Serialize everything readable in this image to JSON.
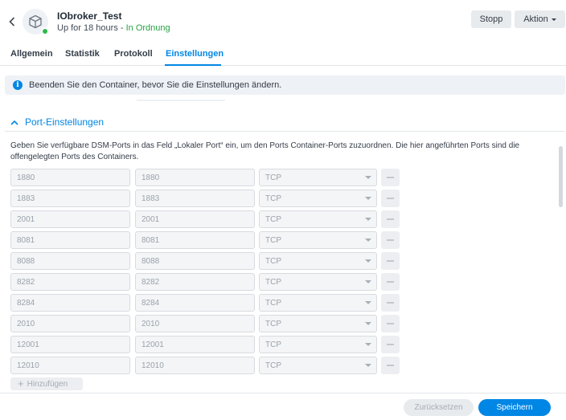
{
  "header": {
    "title": "IObroker_Test",
    "uptime": "Up for 18 hours - ",
    "status": "In Ordnung",
    "stop_label": "Stopp",
    "action_label": "Aktion"
  },
  "tabs": [
    {
      "label": "Allgemein"
    },
    {
      "label": "Statistik"
    },
    {
      "label": "Protokoll"
    },
    {
      "label": "Einstellungen",
      "active": true
    }
  ],
  "info": {
    "message": "Beenden Sie den Container, bevor Sie die Einstellungen ändern."
  },
  "port_section": {
    "title": "Port-Einstellungen",
    "description": "Geben Sie verfügbare DSM-Ports in das Feld „Lokaler Port“ ein, um den Ports Container-Ports zuzuordnen. Die hier angeführten Ports sind die offengelegten Ports des Containers.",
    "rows": [
      {
        "local": "1880",
        "container": "1880",
        "type": "TCP"
      },
      {
        "local": "1883",
        "container": "1883",
        "type": "TCP"
      },
      {
        "local": "2001",
        "container": "2001",
        "type": "TCP"
      },
      {
        "local": "8081",
        "container": "8081",
        "type": "TCP"
      },
      {
        "local": "8088",
        "container": "8088",
        "type": "TCP"
      },
      {
        "local": "8282",
        "container": "8282",
        "type": "TCP"
      },
      {
        "local": "8284",
        "container": "8284",
        "type": "TCP"
      },
      {
        "local": "2010",
        "container": "2010",
        "type": "TCP"
      },
      {
        "local": "12001",
        "container": "12001",
        "type": "TCP"
      },
      {
        "local": "12010",
        "container": "12010",
        "type": "TCP"
      }
    ],
    "add_label": "Hinzufügen"
  },
  "footer": {
    "reset_label": "Zurücksetzen",
    "save_label": "Speichern"
  },
  "colors": {
    "accent": "#0086e5",
    "status_ok": "#27a243"
  }
}
